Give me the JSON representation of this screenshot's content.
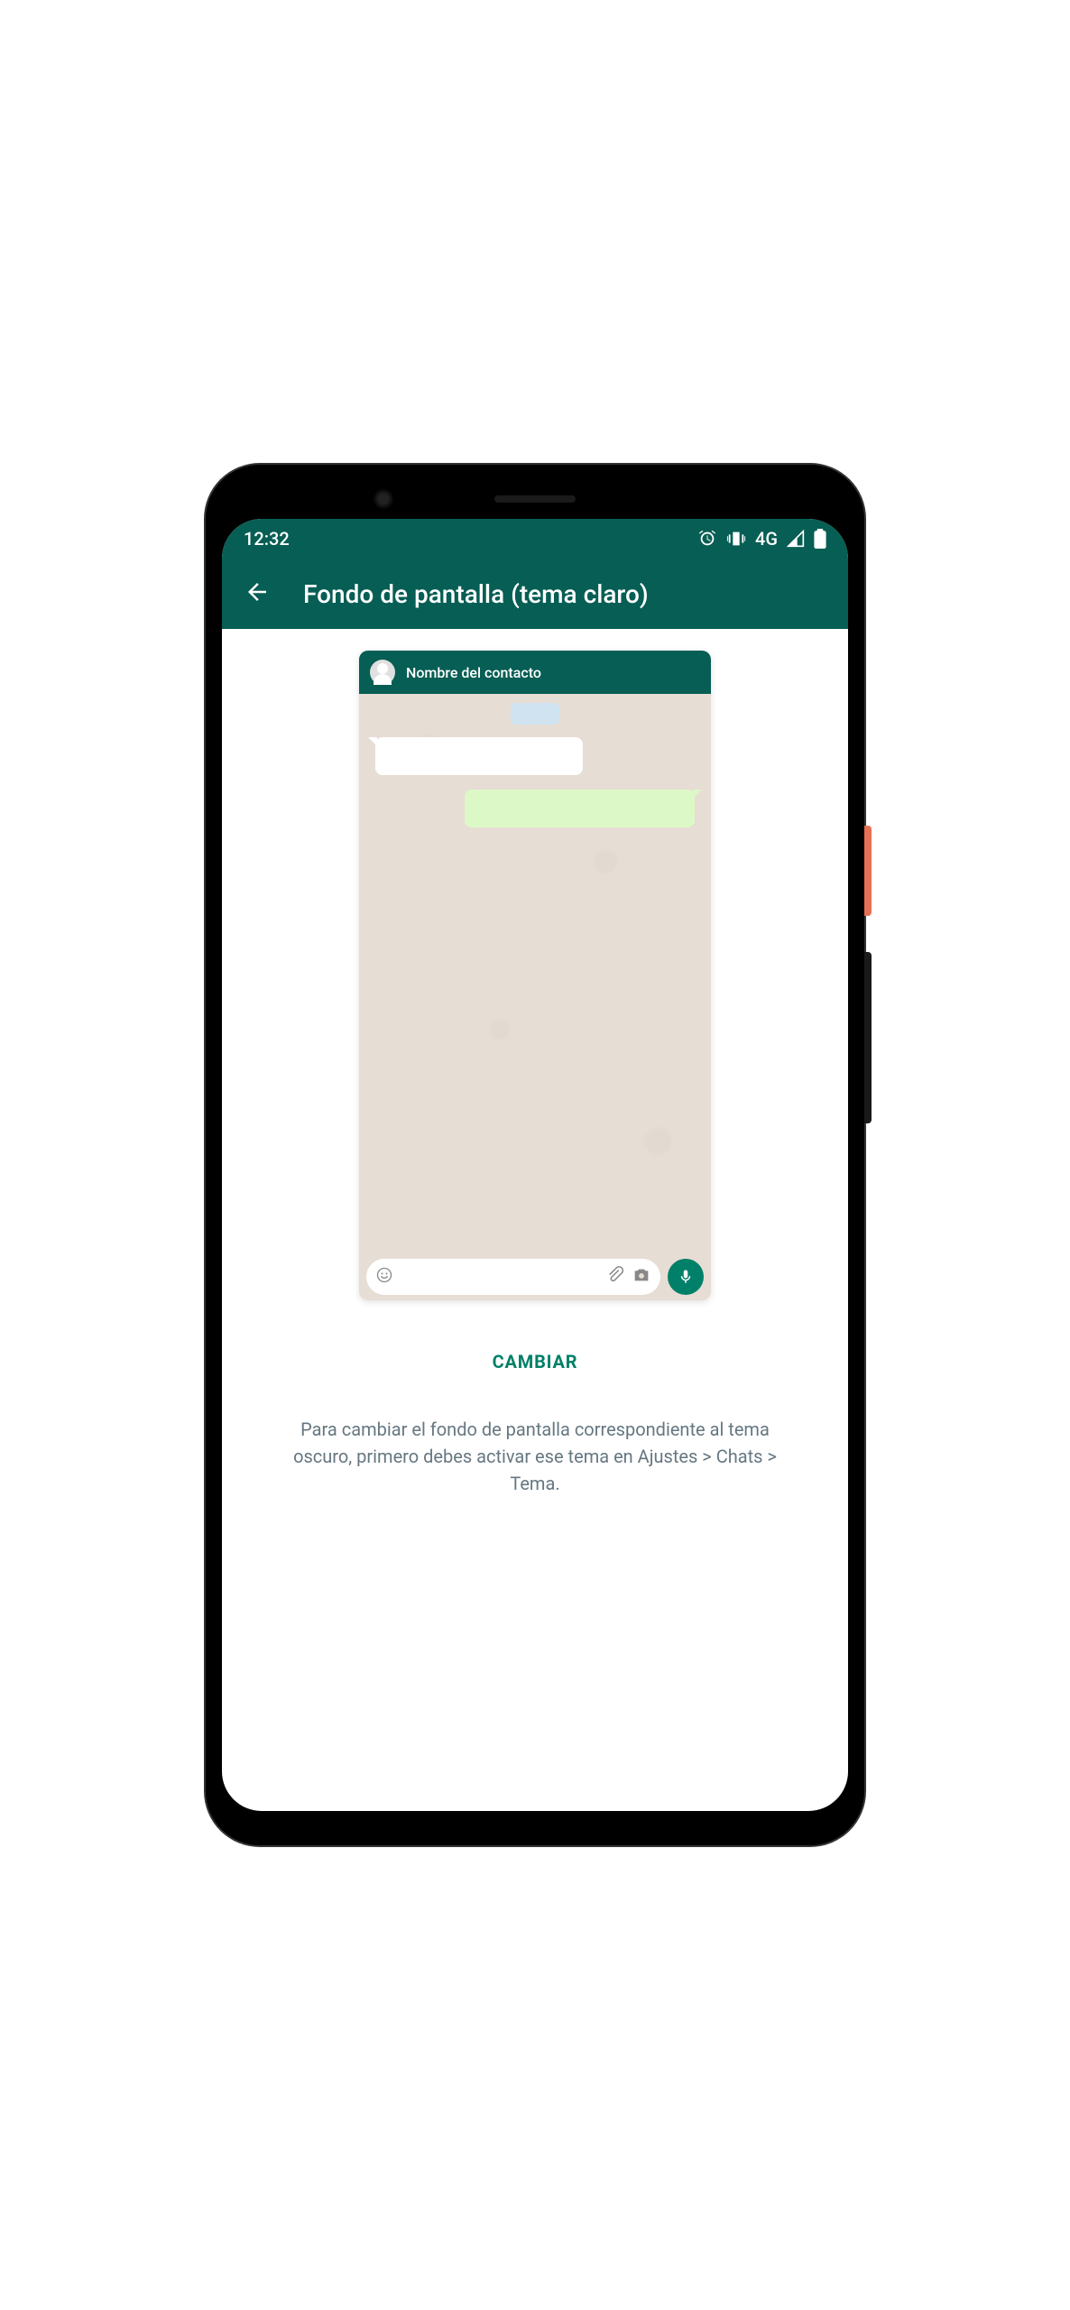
{
  "status": {
    "time": "12:32",
    "network": "4G"
  },
  "appbar": {
    "title": "Fondo de pantalla (tema claro)"
  },
  "preview": {
    "contact_name": "Nombre del contacto"
  },
  "actions": {
    "change_label": "CAMBIAR"
  },
  "help": {
    "text": "Para cambiar el fondo de pantalla correspondiente al tema oscuro, primero debes activar ese tema en Ajustes > Chats > Tema."
  }
}
